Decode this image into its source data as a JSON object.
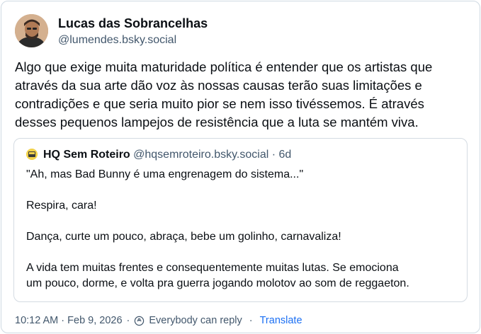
{
  "post": {
    "author": {
      "display_name": "Lucas das Sobrancelhas",
      "handle": "@lumendes.bsky.social",
      "avatar": "user-avatar-photo"
    },
    "text_lines": [
      "Algo que exige muita maturidade política é entender que os artistas que",
      "através da sua arte dão voz às nossas causas terão suas limitações e",
      "contradições e que seria muito pior se nem isso tivéssemos. É através",
      "desses pequenos lampejos de resistência que a luta se mantém viva."
    ],
    "quote": {
      "display_name": "HQ Sem Roteiro",
      "handle": "@hqsemroteiro.bsky.social",
      "separator": "·",
      "time": "6d",
      "paragraphs": [
        [
          "\"Ah, mas Bad Bunny é uma engrenagem do sistema...\""
        ],
        [
          "Respira, cara!"
        ],
        [
          "Dança, curte um pouco, abraça, bebe um golinho, carnavaliza!"
        ],
        [
          "A vida tem muitas frentes e consequentemente muitas lutas. Se emociona",
          "um pouco, dorme, e volta pra guerra jogando molotov ao som de reggaeton."
        ]
      ]
    },
    "footer": {
      "timestamp": "10:12 AM · Feb 9, 2026",
      "reply_icon": "reply-settings-icon",
      "reply_setting": "Everybody can reply",
      "separator": "·",
      "translate": "Translate"
    }
  },
  "colors": {
    "text": "#0b0f14",
    "muted": "#42576c",
    "link": "#1b6ff3",
    "border": "#cfd9e2"
  }
}
